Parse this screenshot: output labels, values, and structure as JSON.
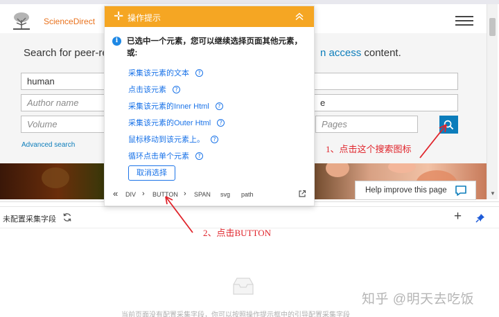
{
  "site": {
    "name": "ScienceDirect",
    "logo_icon": "elsevier-tree-logo",
    "menu_icon": "hamburger-icon"
  },
  "search": {
    "heading_left": "Search for peer-re",
    "heading_link": "n access",
    "heading_right": " content.",
    "fields": {
      "terms_value": "human",
      "author_placeholder": "Author name",
      "journal_partial": "e",
      "volume_placeholder": "Volume",
      "pages_placeholder": "Pages"
    },
    "advanced_link": "Advanced search",
    "button_icon": "search-icon"
  },
  "help_box": {
    "label": "Help improve this page",
    "icon": "chat-icon"
  },
  "tips": {
    "title": "操作提示",
    "message": "已选中一个元素，您可以继续选择页面其他元素，或:",
    "options": [
      "采集该元素的文本",
      "点击该元素",
      "采集该元素的Inner Html",
      "采集该元素的Outer Html",
      "鼠标移动到该元素上。",
      "循环点击单个元素"
    ],
    "cancel_label": "取消选择",
    "breadcrumb": [
      "DIV",
      "BUTTON",
      "SPAN",
      "svg",
      "path"
    ]
  },
  "annotations": {
    "first": "1、点击这个搜索图标",
    "second": "2、点击BUTTON"
  },
  "panel": {
    "title": "未配置采集字段",
    "empty_text": "当前页面没有配置采集字段，你可以按照操作提示框中的引导配置采集字段",
    "watermark": "知乎 @明天去吃饭"
  },
  "colors": {
    "accent_orange": "#f5a623",
    "link_blue": "#1a73e8",
    "site_blue": "#0c7dbb",
    "brand_orange": "#e9711c",
    "annotation_red": "#e0242b"
  }
}
